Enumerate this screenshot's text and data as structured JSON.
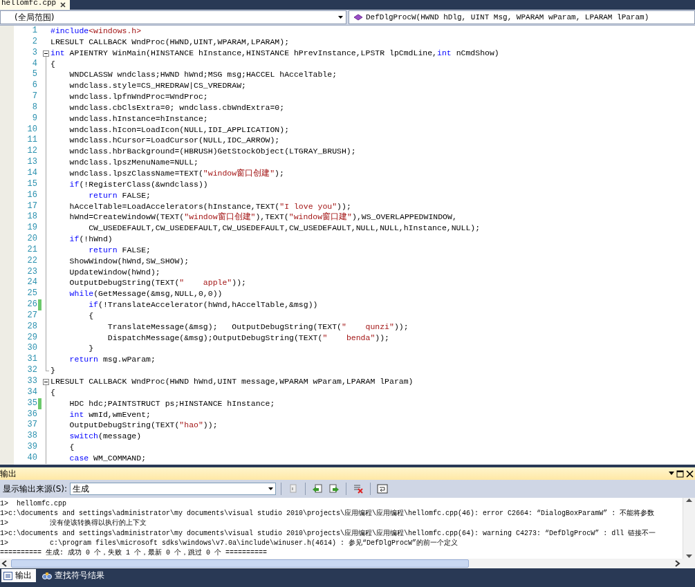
{
  "tab": {
    "title": "hellomfc.cpp",
    "selected": true
  },
  "nav": {
    "scope": "(全局范围)",
    "member": "DefDlgProcW(HWND hDlg, UINT Msg, WPARAM wParam, LPARAM lParam)"
  },
  "editor": {
    "lines": [
      {
        "num": "1",
        "changed": false,
        "kind": "plain",
        "tokens": [
          {
            "kind": "kw",
            "t": "#include"
          },
          {
            "kind": "str",
            "t": "<windows.h>"
          }
        ]
      },
      {
        "num": "2",
        "changed": false,
        "kind": "plain",
        "tokens": [
          {
            "kind": "plain",
            "t": "LRESULT CALLBACK WndProc(HWND,UINT,WPARAM,LPARAM);"
          }
        ]
      },
      {
        "num": "3",
        "changed": false,
        "kind": "header",
        "tokens": [
          {
            "kind": "kw",
            "t": "int"
          },
          {
            "kind": "plain",
            "t": " APIENTRY WinMain(HINSTANCE hInstance,HINSTANCE hPrevInstance,LPSTR lpCmdLine,"
          },
          {
            "kind": "kw",
            "t": "int"
          },
          {
            "kind": "plain",
            "t": " nCmdShow)"
          }
        ]
      },
      {
        "num": "4",
        "changed": false,
        "kind": "body",
        "tokens": [
          {
            "kind": "plain",
            "t": "{"
          }
        ]
      },
      {
        "num": "5",
        "changed": false,
        "kind": "body",
        "tokens": [
          {
            "kind": "plain",
            "t": "    WNDCLASSW wndclass;HWND hWnd;MSG msg;HACCEL hAccelTable;"
          }
        ]
      },
      {
        "num": "6",
        "changed": false,
        "kind": "body",
        "tokens": [
          {
            "kind": "plain",
            "t": "    wndclass.style=CS_HREDRAW|CS_VREDRAW;"
          }
        ]
      },
      {
        "num": "7",
        "changed": false,
        "kind": "body",
        "tokens": [
          {
            "kind": "plain",
            "t": "    wndclass.lpfnWndProc=WndProc;"
          }
        ]
      },
      {
        "num": "8",
        "changed": false,
        "kind": "body",
        "tokens": [
          {
            "kind": "plain",
            "t": "    wndclass.cbClsExtra=0; wndclass.cbWndExtra=0;"
          }
        ]
      },
      {
        "num": "9",
        "changed": false,
        "kind": "body",
        "tokens": [
          {
            "kind": "plain",
            "t": "    wndclass.hInstance=hInstance;"
          }
        ]
      },
      {
        "num": "10",
        "changed": false,
        "kind": "body",
        "tokens": [
          {
            "kind": "plain",
            "t": "    wndclass.hIcon=LoadIcon(NULL,IDI_APPLICATION);"
          }
        ]
      },
      {
        "num": "11",
        "changed": false,
        "kind": "body",
        "tokens": [
          {
            "kind": "plain",
            "t": "    wndclass.hCursor=LoadCursor(NULL,IDC_ARROW);"
          }
        ]
      },
      {
        "num": "12",
        "changed": false,
        "kind": "body",
        "tokens": [
          {
            "kind": "plain",
            "t": "    wndclass.hbrBackground=(HBRUSH)GetStockObject(LTGRAY_BRUSH);"
          }
        ]
      },
      {
        "num": "13",
        "changed": false,
        "kind": "body",
        "tokens": [
          {
            "kind": "plain",
            "t": "    wndclass.lpszMenuName=NULL;"
          }
        ]
      },
      {
        "num": "14",
        "changed": false,
        "kind": "body",
        "tokens": [
          {
            "kind": "plain",
            "t": "    wndclass.lpszClassName=TEXT("
          },
          {
            "kind": "str",
            "t": "\"window窗口创建\""
          },
          {
            "kind": "plain",
            "t": ");"
          }
        ]
      },
      {
        "num": "15",
        "changed": false,
        "kind": "body",
        "tokens": [
          {
            "kind": "kw",
            "t": "    if"
          },
          {
            "kind": "plain",
            "t": "(!RegisterClass(&wndclass))"
          }
        ]
      },
      {
        "num": "16",
        "changed": false,
        "kind": "body",
        "tokens": [
          {
            "kind": "kw",
            "t": "        return"
          },
          {
            "kind": "plain",
            "t": " FALSE;"
          }
        ]
      },
      {
        "num": "17",
        "changed": false,
        "kind": "body",
        "tokens": [
          {
            "kind": "plain",
            "t": "    hAccelTable=LoadAccelerators(hInstance,TEXT("
          },
          {
            "kind": "str",
            "t": "\"I love you\""
          },
          {
            "kind": "plain",
            "t": "));"
          }
        ]
      },
      {
        "num": "18",
        "changed": false,
        "kind": "body",
        "tokens": [
          {
            "kind": "plain",
            "t": "    hWnd=CreateWindowW(TEXT("
          },
          {
            "kind": "str",
            "t": "\"window窗口创建\""
          },
          {
            "kind": "plain",
            "t": "),TEXT("
          },
          {
            "kind": "str",
            "t": "\"window窗口建\""
          },
          {
            "kind": "plain",
            "t": "),WS_OVERLAPPEDWINDOW,"
          }
        ]
      },
      {
        "num": "19",
        "changed": false,
        "kind": "body",
        "tokens": [
          {
            "kind": "plain",
            "t": "        CW_USEDEFAULT,CW_USEDEFAULT,CW_USEDEFAULT,CW_USEDEFAULT,NULL,NULL,hInstance,NULL);"
          }
        ]
      },
      {
        "num": "20",
        "changed": false,
        "kind": "body",
        "tokens": [
          {
            "kind": "kw",
            "t": "    if"
          },
          {
            "kind": "plain",
            "t": "(!hWnd)"
          }
        ]
      },
      {
        "num": "21",
        "changed": false,
        "kind": "body",
        "tokens": [
          {
            "kind": "kw",
            "t": "        return"
          },
          {
            "kind": "plain",
            "t": " FALSE;"
          }
        ]
      },
      {
        "num": "22",
        "changed": false,
        "kind": "body",
        "tokens": [
          {
            "kind": "plain",
            "t": "    ShowWindow(hWnd,SW_SHOW);"
          }
        ]
      },
      {
        "num": "23",
        "changed": false,
        "kind": "body",
        "tokens": [
          {
            "kind": "plain",
            "t": "    UpdateWindow(hWnd);"
          }
        ]
      },
      {
        "num": "24",
        "changed": false,
        "kind": "body",
        "tokens": [
          {
            "kind": "plain",
            "t": "    OutputDebugString(TEXT("
          },
          {
            "kind": "str",
            "t": "\"    apple\""
          },
          {
            "kind": "plain",
            "t": "));"
          }
        ]
      },
      {
        "num": "25",
        "changed": false,
        "kind": "body",
        "tokens": [
          {
            "kind": "kw",
            "t": "    while"
          },
          {
            "kind": "plain",
            "t": "(GetMessage(&msg,NULL,0,0))"
          }
        ]
      },
      {
        "num": "26",
        "changed": true,
        "kind": "body",
        "tokens": [
          {
            "kind": "kw",
            "t": "        if"
          },
          {
            "kind": "plain",
            "t": "(!TranslateAccelerator(hWnd,hAccelTable,&msg))"
          }
        ]
      },
      {
        "num": "27",
        "changed": false,
        "kind": "body",
        "tokens": [
          {
            "kind": "plain",
            "t": "        {"
          }
        ]
      },
      {
        "num": "28",
        "changed": false,
        "kind": "body",
        "tokens": [
          {
            "kind": "plain",
            "t": "            TranslateMessage(&msg);   OutputDebugString(TEXT("
          },
          {
            "kind": "str",
            "t": "\"    qunzi\""
          },
          {
            "kind": "plain",
            "t": "));"
          }
        ]
      },
      {
        "num": "29",
        "changed": false,
        "kind": "body",
        "tokens": [
          {
            "kind": "plain",
            "t": "            DispatchMessage(&msg);OutputDebugString(TEXT("
          },
          {
            "kind": "str",
            "t": "\"    benda\""
          },
          {
            "kind": "plain",
            "t": "));"
          }
        ]
      },
      {
        "num": "30",
        "changed": false,
        "kind": "body",
        "tokens": [
          {
            "kind": "plain",
            "t": "        }"
          }
        ]
      },
      {
        "num": "31",
        "changed": false,
        "kind": "body",
        "tokens": [
          {
            "kind": "kw",
            "t": "    return"
          },
          {
            "kind": "plain",
            "t": " msg.wParam;"
          }
        ]
      },
      {
        "num": "32",
        "changed": false,
        "kind": "closer",
        "tokens": [
          {
            "kind": "plain",
            "t": "}"
          }
        ]
      },
      {
        "num": "33",
        "changed": false,
        "kind": "header",
        "tokens": [
          {
            "kind": "plain",
            "t": "LRESULT CALLBACK WndProc(HWND hWnd,UINT message,WPARAM wParam,LPARAM lParam)"
          }
        ]
      },
      {
        "num": "34",
        "changed": false,
        "kind": "body",
        "tokens": [
          {
            "kind": "plain",
            "t": "{"
          }
        ]
      },
      {
        "num": "35",
        "changed": true,
        "kind": "body",
        "tokens": [
          {
            "kind": "plain",
            "t": "    HDC hdc;PAINTSTRUCT ps;HINSTANCE hInstance;"
          }
        ]
      },
      {
        "num": "36",
        "changed": false,
        "kind": "body",
        "tokens": [
          {
            "kind": "kw",
            "t": "    int"
          },
          {
            "kind": "plain",
            "t": " wmId,wmEvent;"
          }
        ]
      },
      {
        "num": "37",
        "changed": false,
        "kind": "body",
        "tokens": [
          {
            "kind": "plain",
            "t": "    OutputDebugString(TEXT("
          },
          {
            "kind": "str",
            "t": "\"hao\""
          },
          {
            "kind": "plain",
            "t": "));"
          }
        ]
      },
      {
        "num": "38",
        "changed": false,
        "kind": "body",
        "tokens": [
          {
            "kind": "kw",
            "t": "    switch"
          },
          {
            "kind": "plain",
            "t": "(message)"
          }
        ]
      },
      {
        "num": "39",
        "changed": false,
        "kind": "body",
        "tokens": [
          {
            "kind": "plain",
            "t": "    {"
          }
        ]
      },
      {
        "num": "40",
        "changed": false,
        "kind": "body",
        "tokens": [
          {
            "kind": "kw",
            "t": "    case"
          },
          {
            "kind": "plain",
            "t": " WM_COMMAND;"
          }
        ]
      }
    ]
  },
  "output": {
    "title": "输出",
    "source_label": "显示输出来源(S):",
    "source": "生成",
    "lines": [
      "1>  hellomfc.cpp",
      "1>c:\\documents and settings\\administrator\\my documents\\visual studio 2010\\projects\\应用编程\\应用编程\\hellomfc.cpp(46): error C2664: “DialogBoxParamW” : 不能将参数",
      "1>          没有使该转换得以执行的上下文",
      "1>c:\\documents and settings\\administrator\\my documents\\visual studio 2010\\projects\\应用编程\\应用编程\\hellomfc.cpp(64): warning C4273: “DefDlgProcW” : dll 链接不一",
      "1>          c:\\program files\\microsoft sdks\\windows\\v7.0a\\include\\winuser.h(4614) : 参见“DefDlgProcW”的前一个定义",
      "========== 生成: 成功 0 个，失败 1 个，最新 0 个，跳过 0 个 =========="
    ]
  },
  "bottom_tabs": [
    {
      "label": "输出",
      "selected": true
    },
    {
      "label": "查找符号结果",
      "selected": false
    }
  ]
}
